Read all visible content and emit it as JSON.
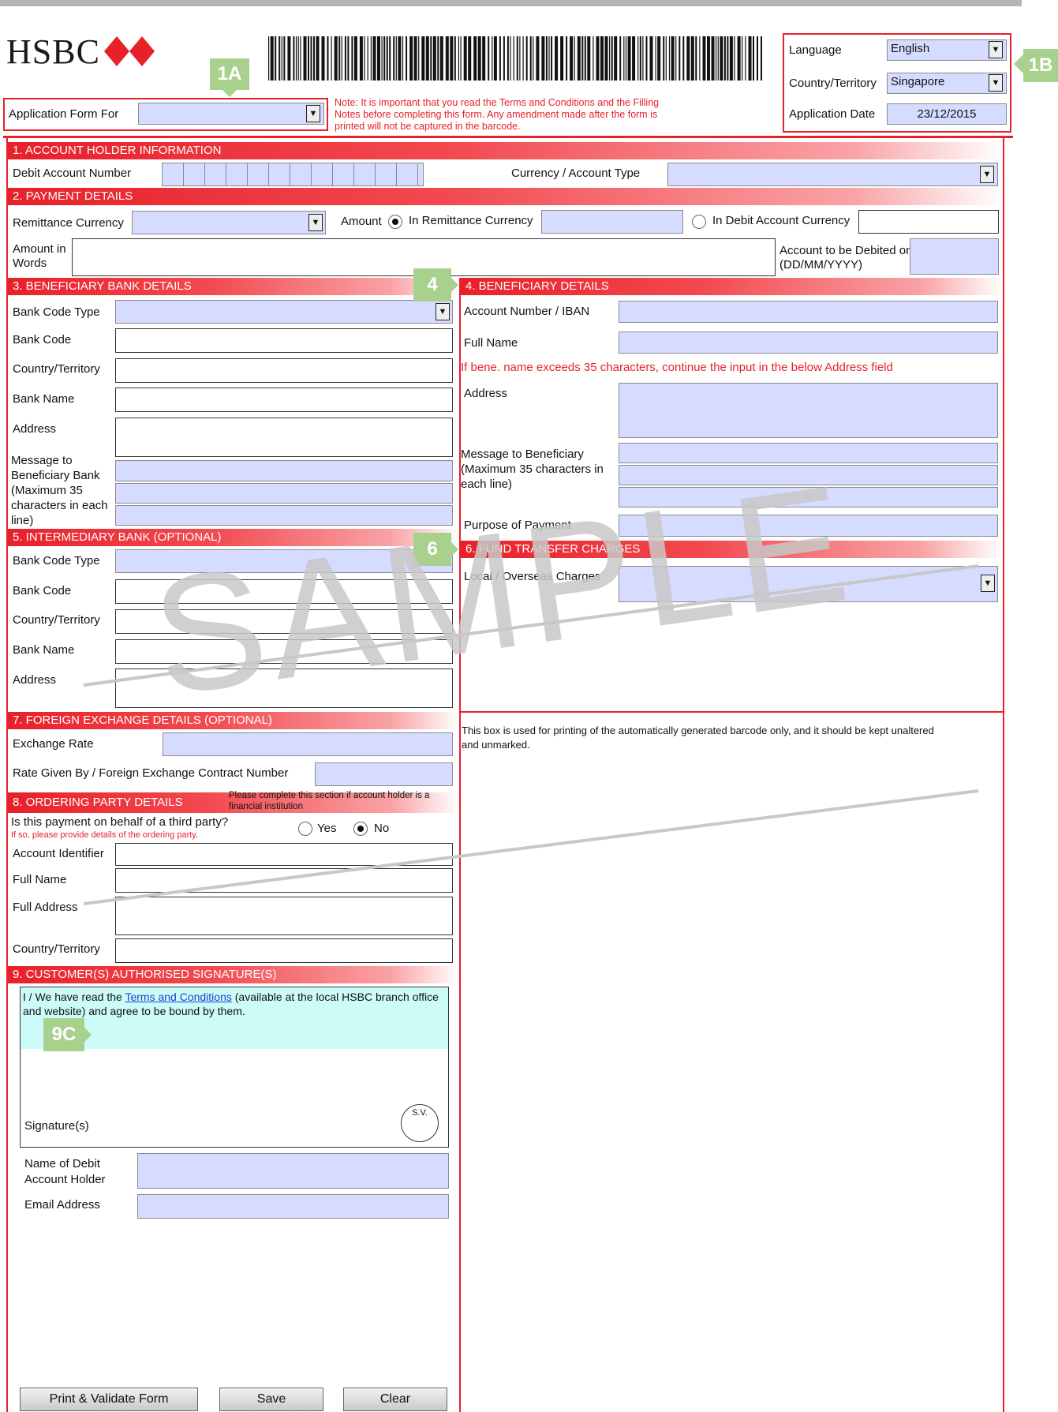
{
  "header": {
    "logo_text": "HSBC",
    "marker_1a": "1A",
    "marker_1b": "1B",
    "application_form_for_label": "Application Form For",
    "application_form_for_value": "",
    "note": "Note: It is important that you read the Terms and Conditions and the Filling Notes before completing this form. Any amendment made after the form is printed will not be captured in the barcode.",
    "language_label": "Language",
    "language_value": "English",
    "country_label": "Country/Territory",
    "country_value": "Singapore",
    "date_label": "Application Date",
    "date_value": "23/12/2015"
  },
  "s1": {
    "title": "1. ACCOUNT HOLDER INFORMATION",
    "debit_account_label": "Debit Account Number",
    "currency_type_label": "Currency / Account Type"
  },
  "s2": {
    "title": "2. PAYMENT DETAILS",
    "remittance_currency_label": "Remittance Currency",
    "amount_label": "Amount",
    "in_remittance_label": "In Remittance Currency",
    "in_debit_label": "In Debit Account Currency",
    "amount_words_label": "Amount in Words",
    "account_debited_label": "Account to be Debited on (DD/MM/YYYY)"
  },
  "s3": {
    "title": "3. BENEFICIARY BANK DETAILS",
    "bank_code_type": "Bank Code Type",
    "bank_code": "Bank Code",
    "country": "Country/Territory",
    "bank_name": "Bank Name",
    "address": "Address",
    "message": "Message to Beneficiary Bank (Maximum 35 characters in each line)"
  },
  "s4": {
    "marker": "4",
    "title": "4. BENEFICIARY DETAILS",
    "account_number": "Account Number / IBAN",
    "full_name": "Full Name",
    "name_note": "If bene. name exceeds 35 characters, continue the input in the below Address field",
    "address": "Address",
    "message": "Message to Beneficiary (Maximum 35 characters in each line)",
    "purpose": "Purpose of Payment"
  },
  "s5": {
    "title": "5. INTERMEDIARY BANK (OPTIONAL)",
    "bank_code_type": "Bank Code Type",
    "bank_code": "Bank Code",
    "country": "Country/Territory",
    "bank_name": "Bank Name",
    "address": "Address"
  },
  "s6": {
    "marker": "6",
    "title": "6. FUND TRANSFER CHARGES",
    "charges_label": "Local / Overseas Charges"
  },
  "s7": {
    "title": "7. FOREIGN EXCHANGE DETAILS (OPTIONAL)",
    "exchange_rate": "Exchange Rate",
    "rate_given_by": "Rate Given By / Foreign Exchange Contract Number"
  },
  "barcode_box_note": "This box is used for printing of the automatically generated barcode only, and it should be kept unaltered and unmarked.",
  "s8": {
    "title": "8. ORDERING PARTY DETAILS",
    "header_note": "Please complete this section if account holder is a financial institution",
    "question": "Is this payment on behalf of a third party?",
    "question_note": "If so, please provide details of the ordering party.",
    "yes": "Yes",
    "no": "No",
    "account_identifier": "Account Identifier",
    "full_name": "Full Name",
    "full_address": "Full Address",
    "country": "Country/Territory"
  },
  "s9": {
    "title": "9. CUSTOMER(S) AUTHORISED SIGNATURE(S)",
    "terms_prefix": "I / We have read the ",
    "terms_link": "Terms and Conditions",
    "terms_suffix": " (available at the local HSBC branch office and website) and agree to be bound by them.",
    "marker": "9C",
    "signature_label": "Signature(s)",
    "sv": "S.V.",
    "name_label": "Name of Debit Account Holder",
    "email_label": "Email Address"
  },
  "buttons": {
    "print": "Print & Validate Form",
    "save": "Save",
    "clear": "Clear"
  },
  "watermark": "SAMPLE",
  "colors": {
    "brand_red": "#e8202a",
    "field_blue": "#d6dcff",
    "marker_green": "#a9d18e",
    "terms_box": "#ccfbf8"
  }
}
